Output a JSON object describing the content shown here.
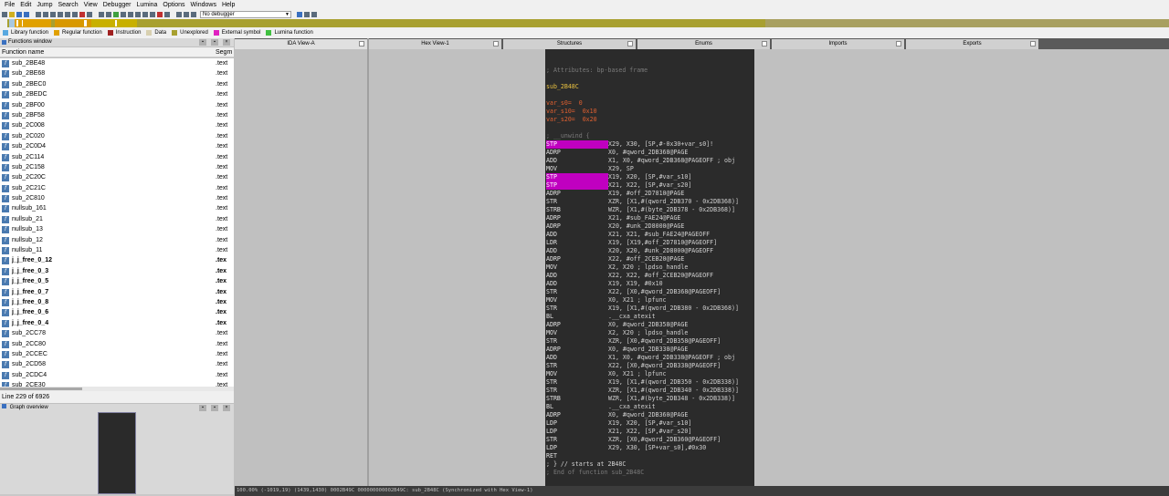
{
  "menu": [
    "File",
    "Edit",
    "Jump",
    "Search",
    "View",
    "Debugger",
    "Lumina",
    "Options",
    "Windows",
    "Help"
  ],
  "toolbar": {
    "debugger_select": "No debugger"
  },
  "legend": [
    {
      "label": "Library function",
      "color": "#58a8e0"
    },
    {
      "label": "Regular function",
      "color": "#e0a000"
    },
    {
      "label": "Instruction",
      "color": "#a02020"
    },
    {
      "label": "Data",
      "color": "#d8d0b0"
    },
    {
      "label": "Unexplored",
      "color": "#a8a030"
    },
    {
      "label": "External symbol",
      "color": "#e020c0"
    },
    {
      "label": "Lumina function",
      "color": "#40c040"
    }
  ],
  "functions_window": {
    "title": "Functions window",
    "col_name": "Function name",
    "col_seg": "Segm",
    "rows": [
      {
        "name": "sub_2BE48",
        "seg": ".text",
        "bold": false
      },
      {
        "name": "sub_2BE68",
        "seg": ".text",
        "bold": false
      },
      {
        "name": "sub_2BEC0",
        "seg": ".text",
        "bold": false
      },
      {
        "name": "sub_2BEDC",
        "seg": ".text",
        "bold": false
      },
      {
        "name": "sub_2BF00",
        "seg": ".text",
        "bold": false
      },
      {
        "name": "sub_2BF58",
        "seg": ".text",
        "bold": false
      },
      {
        "name": "sub_2C008",
        "seg": ".text",
        "bold": false
      },
      {
        "name": "sub_2C020",
        "seg": ".text",
        "bold": false
      },
      {
        "name": "sub_2C0D4",
        "seg": ".text",
        "bold": false
      },
      {
        "name": "sub_2C114",
        "seg": ".text",
        "bold": false
      },
      {
        "name": "sub_2C158",
        "seg": ".text",
        "bold": false
      },
      {
        "name": "sub_2C20C",
        "seg": ".text",
        "bold": false
      },
      {
        "name": "sub_2C21C",
        "seg": ".text",
        "bold": false
      },
      {
        "name": "sub_2C810",
        "seg": ".text",
        "bold": false
      },
      {
        "name": "nullsub_161",
        "seg": ".text",
        "bold": false
      },
      {
        "name": "nullsub_21",
        "seg": ".text",
        "bold": false
      },
      {
        "name": "nullsub_13",
        "seg": ".text",
        "bold": false
      },
      {
        "name": "nullsub_12",
        "seg": ".text",
        "bold": false
      },
      {
        "name": "nullsub_11",
        "seg": ".text",
        "bold": false
      },
      {
        "name": "j_j_free_0_12",
        "seg": ".tex",
        "bold": true
      },
      {
        "name": "j_j_free_0_3",
        "seg": ".tex",
        "bold": true
      },
      {
        "name": "j_j_free_0_5",
        "seg": ".tex",
        "bold": true
      },
      {
        "name": "j_j_free_0_7",
        "seg": ".tex",
        "bold": true
      },
      {
        "name": "j_j_free_0_8",
        "seg": ".tex",
        "bold": true
      },
      {
        "name": "j_j_free_0_6",
        "seg": ".tex",
        "bold": true
      },
      {
        "name": "j_j_free_0_4",
        "seg": ".tex",
        "bold": true
      },
      {
        "name": "sub_2CC78",
        "seg": ".text",
        "bold": false
      },
      {
        "name": "sub_2CC80",
        "seg": ".text",
        "bold": false
      },
      {
        "name": "sub_2CCEC",
        "seg": ".text",
        "bold": false
      },
      {
        "name": "sub_2CD58",
        "seg": ".text",
        "bold": false
      },
      {
        "name": "sub_2CDC4",
        "seg": ".text",
        "bold": false
      },
      {
        "name": "sub_2CE30",
        "seg": ".text",
        "bold": false
      }
    ],
    "status": "Line 229 of 6926"
  },
  "graph_overview": {
    "title": "Graph overview"
  },
  "tabs": [
    {
      "label": "IDA View-A",
      "active": true
    },
    {
      "label": "Hex View-1",
      "active": false
    },
    {
      "label": "Structures",
      "active": false
    },
    {
      "label": "Enums",
      "active": false
    },
    {
      "label": "Imports",
      "active": false
    },
    {
      "label": "Exports",
      "active": false
    }
  ],
  "code_lines": [
    {
      "op": "",
      "args": "; Attributes: bp-based frame",
      "style": "comment"
    },
    {
      "op": "",
      "args": "",
      "style": "blank"
    },
    {
      "op": "",
      "args": "sub_2B48C",
      "style": "label"
    },
    {
      "op": "",
      "args": "",
      "style": "blank"
    },
    {
      "op": "",
      "args": "var_s0=  0",
      "style": "var"
    },
    {
      "op": "",
      "args": "var_s10=  0x10",
      "style": "var"
    },
    {
      "op": "",
      "args": "var_s20=  0x20",
      "style": "var"
    },
    {
      "op": "",
      "args": "",
      "style": "blank"
    },
    {
      "op": "",
      "args": "; __unwind {",
      "style": "comment"
    },
    {
      "op": "STP",
      "args": "X29, X30, [SP,#-0x30+var_s0]!",
      "style": "pink"
    },
    {
      "op": "ADRP",
      "args": "X0, #qword_2DB368@PAGE",
      "style": "normal"
    },
    {
      "op": "ADD",
      "args": "X1, X0, #qword_2DB368@PAGEOFF ; obj",
      "style": "normal"
    },
    {
      "op": "MOV",
      "args": "X29, SP",
      "style": "normal"
    },
    {
      "op": "STP",
      "args": "X19, X20, [SP,#var_s10]",
      "style": "pink"
    },
    {
      "op": "STP",
      "args": "X21, X22, [SP,#var_s20]",
      "style": "pink"
    },
    {
      "op": "ADRP",
      "args": "X19, #off_2D7810@PAGE",
      "style": "normal"
    },
    {
      "op": "STR",
      "args": "XZR, [X1,#(qword_2DB370 - 0x2DB368)]",
      "style": "normal"
    },
    {
      "op": "STRB",
      "args": "WZR, [X1,#(byte_2DB378 - 0x2DB368)]",
      "style": "normal"
    },
    {
      "op": "ADRP",
      "args": "X21, #sub_FAE24@PAGE",
      "style": "normal"
    },
    {
      "op": "ADRP",
      "args": "X20, #unk_2D8000@PAGE",
      "style": "normal"
    },
    {
      "op": "ADD",
      "args": "X21, X21, #sub_FAE24@PAGEOFF",
      "style": "normal"
    },
    {
      "op": "LDR",
      "args": "X19, [X19,#off_2D7810@PAGEOFF]",
      "style": "normal"
    },
    {
      "op": "ADD",
      "args": "X20, X20, #unk_2D8000@PAGEOFF",
      "style": "normal"
    },
    {
      "op": "ADRP",
      "args": "X22, #off_2CEB20@PAGE",
      "style": "normal"
    },
    {
      "op": "MOV",
      "args": "X2, X20 ; lpdso_handle",
      "style": "normal"
    },
    {
      "op": "ADD",
      "args": "X22, X22, #off_2CEB20@PAGEOFF",
      "style": "normal"
    },
    {
      "op": "ADD",
      "args": "X19, X19, #0x10",
      "style": "normal"
    },
    {
      "op": "STR",
      "args": "X22, [X0,#qword_2DB368@PAGEOFF]",
      "style": "normal"
    },
    {
      "op": "MOV",
      "args": "X0, X21 ; lpfunc",
      "style": "normal"
    },
    {
      "op": "STR",
      "args": "X19, [X1,#(qword_2DB380 - 0x2DB368)]",
      "style": "normal"
    },
    {
      "op": "BL",
      "args": ".__cxa_atexit",
      "style": "normal"
    },
    {
      "op": "ADRP",
      "args": "X0, #qword_2DB358@PAGE",
      "style": "normal"
    },
    {
      "op": "MOV",
      "args": "X2, X20 ; lpdso_handle",
      "style": "normal"
    },
    {
      "op": "STR",
      "args": "XZR, [X0,#qword_2DB358@PAGEOFF]",
      "style": "normal"
    },
    {
      "op": "ADRP",
      "args": "X0, #qword_2DB338@PAGE",
      "style": "normal"
    },
    {
      "op": "ADD",
      "args": "X1, X0, #qword_2DB338@PAGEOFF ; obj",
      "style": "normal"
    },
    {
      "op": "STR",
      "args": "X22, [X0,#qword_2DB338@PAGEOFF]",
      "style": "normal"
    },
    {
      "op": "MOV",
      "args": "X0, X21 ; lpfunc",
      "style": "normal"
    },
    {
      "op": "STR",
      "args": "X19, [X1,#(qword_2DB350 - 0x2DB338)]",
      "style": "normal"
    },
    {
      "op": "STR",
      "args": "XZR, [X1,#(qword_2DB340 - 0x2DB338)]",
      "style": "normal"
    },
    {
      "op": "STRB",
      "args": "WZR, [X1,#(byte_2DB348 - 0x2DB338)]",
      "style": "normal"
    },
    {
      "op": "BL",
      "args": ".__cxa_atexit",
      "style": "normal"
    },
    {
      "op": "ADRP",
      "args": "X0, #qword_2DB360@PAGE",
      "style": "normal"
    },
    {
      "op": "LDP",
      "args": "X19, X20, [SP,#var_s10]",
      "style": "normal"
    },
    {
      "op": "LDP",
      "args": "X21, X22, [SP,#var_s20]",
      "style": "normal"
    },
    {
      "op": "STR",
      "args": "XZR, [X0,#qword_2DB360@PAGEOFF]",
      "style": "normal"
    },
    {
      "op": "LDP",
      "args": "X29, X30, [SP+var_s0],#0x30",
      "style": "normal"
    },
    {
      "op": "RET",
      "args": "",
      "style": "normal"
    },
    {
      "op": "",
      "args": "; } // starts at 2B48C",
      "style": "normal_text"
    },
    {
      "op": "",
      "args": "; End of function sub_2B48C",
      "style": "comment"
    }
  ],
  "statusbar": "100.00% (-1019,19) (1439,1430) 0002B49C 000000000002B49C: sub_2B48C (Synchronized with Hex View-1)"
}
